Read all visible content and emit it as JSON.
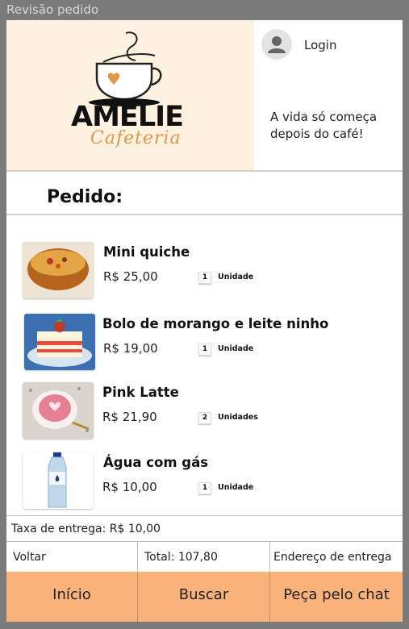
{
  "window": {
    "title": "Revisão pedido"
  },
  "brand": {
    "name": "AMELIE",
    "subname": "Cafeteria",
    "logo_icon": "coffee-cup-heart-icon",
    "accent_color": "#e2964a"
  },
  "header": {
    "login_label": "Login",
    "avatar_icon": "user-avatar-icon",
    "tagline": "A vida só começa depois do café!"
  },
  "order": {
    "title": "Pedido:",
    "items": [
      {
        "name": "Mini quiche",
        "price": "R$ 25,00",
        "qty": "1",
        "unit": "Unidade"
      },
      {
        "name": "Bolo de morango e leite ninho",
        "price": "R$ 19,00",
        "qty": "1",
        "unit": "Unidade"
      },
      {
        "name": "Pink Latte",
        "price": "R$ 21,90",
        "qty": "2",
        "unit": "Unidades"
      },
      {
        "name": "Água com gás",
        "price": "R$ 10,00",
        "qty": "1",
        "unit": "Unidade"
      }
    ]
  },
  "summary": {
    "delivery_fee": "Taxa de entrega: R$ 10,00",
    "back_label": "Voltar",
    "total": "Total: 107,80",
    "address_label": "Endereço de entrega"
  },
  "nav": {
    "home": "Início",
    "search": "Buscar",
    "chat": "Peça pelo chat",
    "color": "#f9b37a"
  }
}
